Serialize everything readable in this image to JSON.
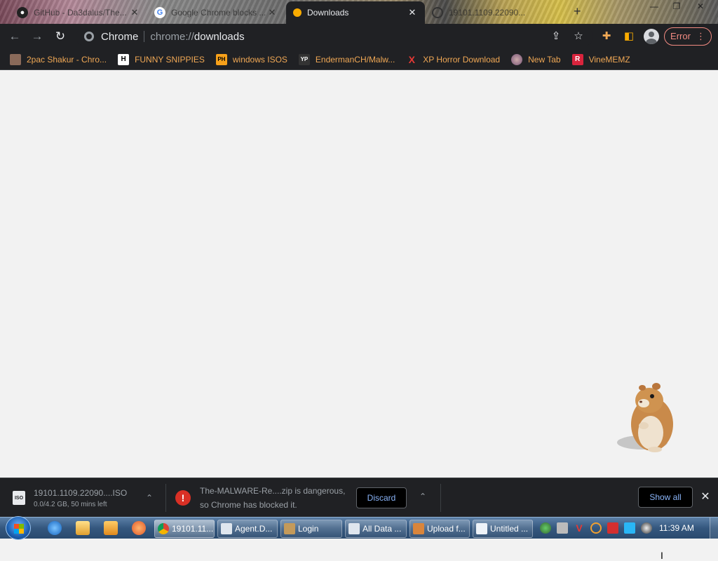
{
  "tabs": [
    {
      "title": "GitHub - Da3dalus/The...",
      "active": false
    },
    {
      "title": "Google Chrome blocks ...",
      "active": false
    },
    {
      "title": "Downloads",
      "active": true
    },
    {
      "title": "19101.1109.22090...",
      "active": false
    }
  ],
  "toolbar": {
    "omnibox_label": "Chrome",
    "url_scheme": "chrome://",
    "url_host": "downloads",
    "error_label": "Error"
  },
  "bookmarks": [
    {
      "label": "2pac Shakur - Chro...",
      "icon": "picture-icon"
    },
    {
      "label": "FUNNY SNIPPIES",
      "icon": "H"
    },
    {
      "label": "windows ISOS",
      "icon": "PH"
    },
    {
      "label": "EndermanCH/Malw...",
      "icon": "YP"
    },
    {
      "label": "XP Horror Download",
      "icon": "X"
    },
    {
      "label": "New Tab",
      "icon": "globe-icon"
    },
    {
      "label": "VineMEMZ",
      "icon": "R"
    }
  ],
  "downloads": {
    "item1": {
      "name": "19101.1109.22090....ISO",
      "status": "0.0/4.2 GB, 50 mins left",
      "icon_text": "ISO"
    },
    "item2": {
      "warning_line1": "The-MALWARE-Re....zip is dangerous,",
      "warning_line2": "so Chrome has blocked it.",
      "discard_label": "Discard"
    },
    "show_all_label": "Show all"
  },
  "taskbar": {
    "tasks": [
      {
        "label": "19101.11...",
        "active": true
      },
      {
        "label": "Agent.D...",
        "active": false
      },
      {
        "label": "Login",
        "active": false
      },
      {
        "label": "All Data ...",
        "active": false
      },
      {
        "label": "Upload f...",
        "active": false
      },
      {
        "label": "Untitled ...",
        "active": false
      }
    ],
    "clock": "11:39 AM"
  },
  "colors": {
    "chrome_dark": "#202124",
    "bookmark_text": "#f0a855",
    "error": "#f28b82",
    "link_blue": "#8ab4f8",
    "danger_red": "#d93025"
  }
}
